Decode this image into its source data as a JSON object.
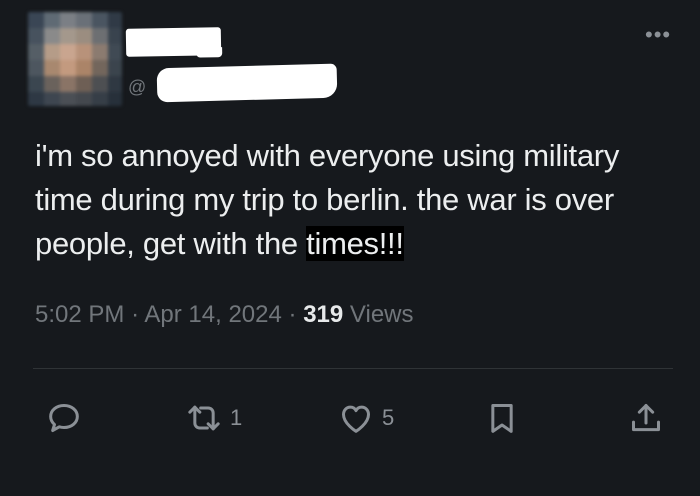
{
  "author": {
    "at_symbol": "@"
  },
  "tweet": {
    "text_before": "i'm so annoyed with everyone using military time during my trip to berlin. the war is over people, get with the ",
    "text_highlight": "times!!!",
    "time": "5:02 PM",
    "separator": "·",
    "date": "Apr 14, 2024",
    "views_count": "319",
    "views_label": "Views"
  },
  "actions": {
    "reply_icon": "reply-icon",
    "retweet_icon": "retweet-icon",
    "retweet_count": "1",
    "like_icon": "heart-icon",
    "like_count": "5",
    "bookmark_icon": "bookmark-icon",
    "share_icon": "share-icon"
  },
  "menu": {
    "more_label": "•••"
  },
  "colors": {
    "background": "#16191d",
    "text": "#e7e9ea",
    "muted": "#71767b",
    "divider": "#2f3336"
  }
}
